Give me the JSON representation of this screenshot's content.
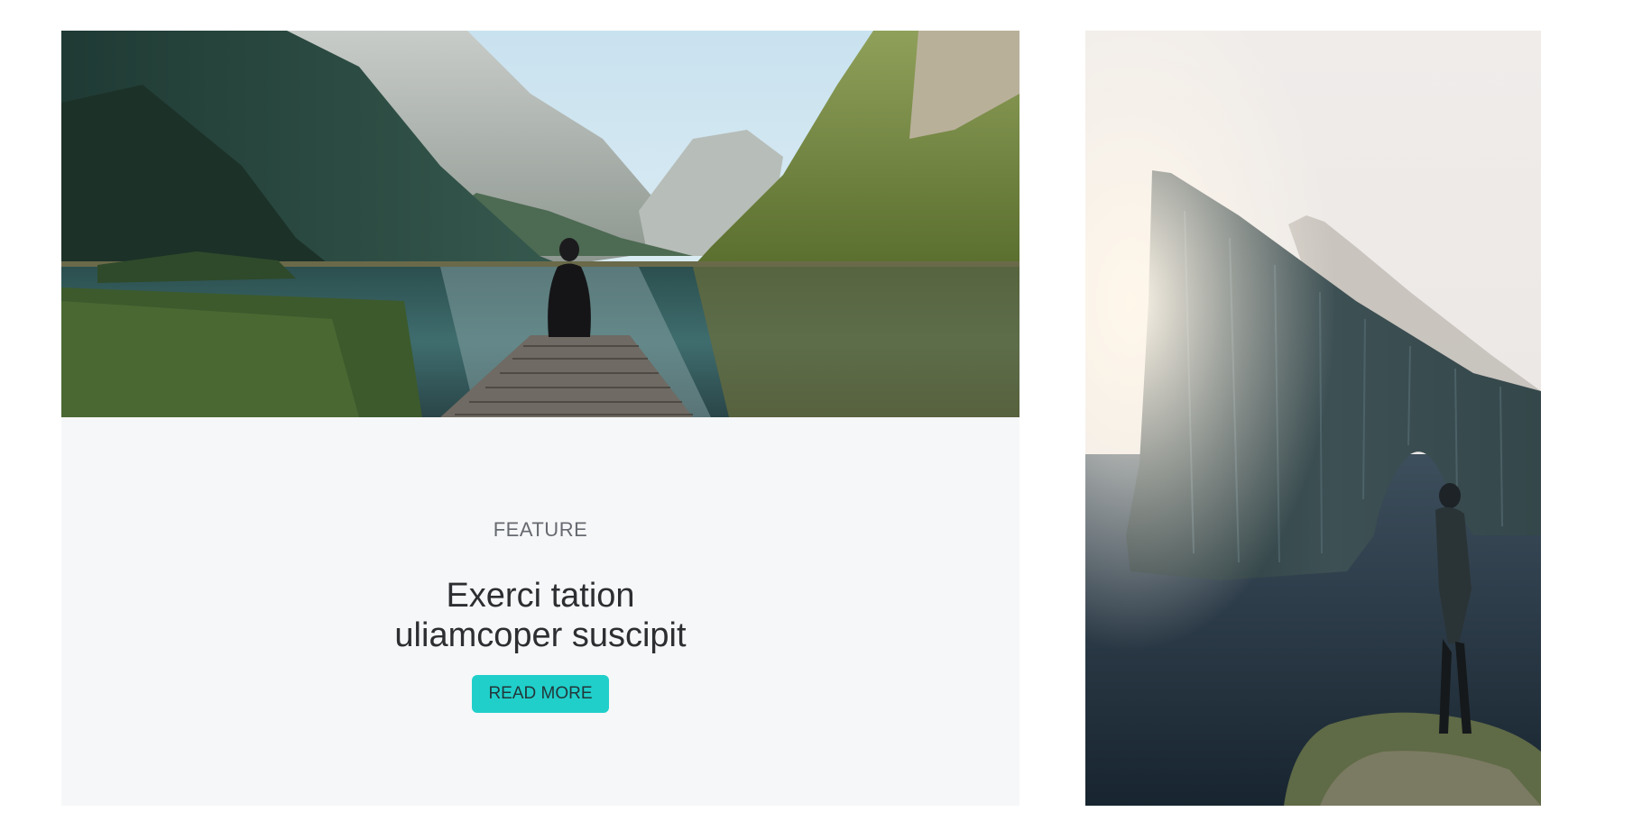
{
  "feature_card": {
    "hero_image_alt": "",
    "category": "FEATURE",
    "title_line1": "Exerci tation",
    "title_line2": "uliamcoper suscipit",
    "read_more_label": "READ MORE"
  },
  "side_image_alt": "",
  "colors": {
    "accent": "#20cfca",
    "card_background": "#f6f7f8",
    "title_text": "#2c2e31",
    "category_text": "#666a70"
  }
}
